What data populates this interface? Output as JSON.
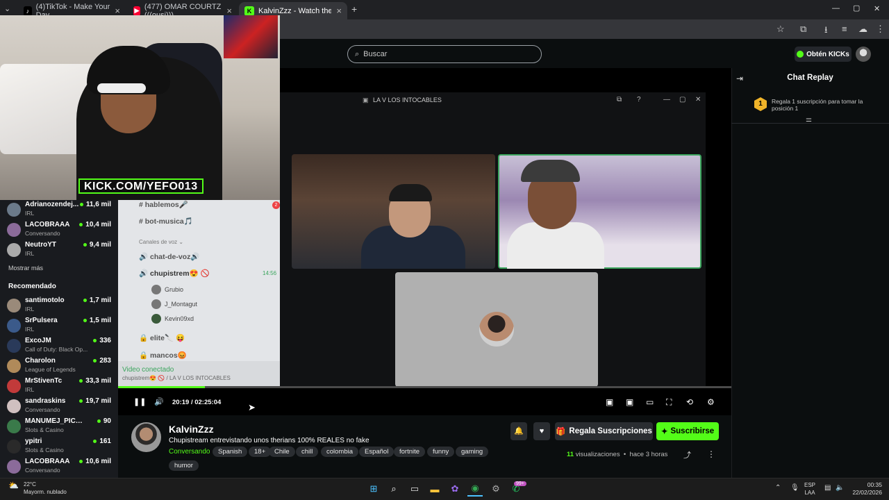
{
  "browser": {
    "tabs": [
      {
        "title": "(4)TikTok - Make Your Day",
        "icon": "tiktok-icon",
        "close": "×"
      },
      {
        "title": "(477) OMAR COURTZ (((ousi))).",
        "icon": "youtube-icon",
        "close": "×"
      },
      {
        "title": "KalvinZzz - Watch the VOD",
        "icon": "kick-icon",
        "close": "×"
      }
    ],
    "new_tab": "+",
    "tab_menu": "⌄",
    "window_controls": [
      "—",
      "▢",
      "✕"
    ],
    "toolbar_icons": [
      "☆",
      "⧉",
      "⭳",
      "≡",
      "☁",
      "⋮"
    ]
  },
  "kick_header": {
    "search_placeholder": "Buscar",
    "kicks_button": "Obtén KICKs"
  },
  "stream_overlay": {
    "kick_url": "KICK.COM/YEFO013"
  },
  "sidebar": {
    "following": [
      {
        "name": "Adrianozendej...",
        "category": "IRL",
        "viewers": "11,6 mil",
        "avatar_color": "#6b7a8a"
      },
      {
        "name": "LACOBRAAA",
        "category": "Conversando",
        "viewers": "10,4 mil",
        "avatar_color": "#8b6b9a"
      },
      {
        "name": "NeutroYT",
        "category": "IRL",
        "viewers": "9,4 mil",
        "avatar_color": "#aaaaaa"
      }
    ],
    "show_more": "Mostrar más",
    "recommended_label": "Recomendado",
    "recommended": [
      {
        "name": "santimotolo",
        "category": "IRL",
        "viewers": "1,7 mil",
        "avatar_color": "#9a8a7a"
      },
      {
        "name": "SrPulsera",
        "category": "IRL",
        "viewers": "1,5 mil",
        "avatar_color": "#3b5a8a"
      },
      {
        "name": "ExcoJM",
        "category": "Call of Duty: Black Op...",
        "viewers": "336",
        "avatar_color": "#2a3a5a"
      },
      {
        "name": "Charolon",
        "category": "League of Legends",
        "viewers": "283",
        "avatar_color": "#b08a5a"
      },
      {
        "name": "MrStivenTc",
        "category": "IRL",
        "viewers": "33,3 mil",
        "avatar_color": "#c23a3a"
      },
      {
        "name": "sandraskins",
        "category": "Conversando",
        "viewers": "19,7 mil",
        "avatar_color": "#d0c0c0"
      },
      {
        "name": "MANUMEJ_PICKS",
        "category": "Slots & Casino",
        "viewers": "90",
        "avatar_color": "#3a7a4a"
      },
      {
        "name": "ypitri",
        "category": "Slots & Casino",
        "viewers": "161",
        "avatar_color": "#2a2a2a"
      },
      {
        "name": "LACOBRAAA",
        "category": "Conversando",
        "viewers": "10,6 mil",
        "avatar_color": "#8b6b9a"
      }
    ]
  },
  "discord": {
    "channels": [
      {
        "name": "# hablemos🎤",
        "badge": "2"
      },
      {
        "name": "# bot-musica🎵",
        "badge": ""
      }
    ],
    "voice_label": "Canales de voz ⌄",
    "voice_channels": [
      {
        "name": "🔊 chat-de-voz🔊"
      },
      {
        "name": "🔊 chupistrem😍 🚫",
        "time": "14:56"
      }
    ],
    "members": [
      "Grubio",
      "J_Montagut",
      "Kevin09xd"
    ],
    "locked": [
      "🔒 elite🔪 😝",
      "🔒 mancos😡"
    ],
    "connected_label": "Video conectado",
    "connected_sub": "chupistrem😍 🚫 / LA V LOS INTOCABLES",
    "window_title": "LA V LOS INTOCABLES",
    "window_controls": [
      "⧉",
      "?",
      "—",
      "▢",
      "✕"
    ]
  },
  "player": {
    "progress_fraction": 0.142,
    "time_current": "20:19",
    "time_total": "02:25:04",
    "time_sep": "/",
    "icons": {
      "pause": "❚❚",
      "volume": "🔊",
      "clip": "▣",
      "theater": "▭",
      "fullscreen": "⛶",
      "speed": "⟲",
      "settings": "⚙"
    }
  },
  "chat": {
    "title": "Chat Replay",
    "gift_rank": "1",
    "gift_text": "Regala 1 suscripción para tomar la posición 1"
  },
  "channel": {
    "name": "KalvinZzz",
    "title": "Chupistream entrevistando unos therians 100% REALES no fake",
    "category": "Conversando",
    "tags": [
      "Spanish",
      "18+",
      "Chile",
      "chill",
      "colombia",
      "Español",
      "fortnite",
      "funny",
      "gaming",
      "humor"
    ],
    "gift_button": "Regala Suscripciones",
    "subscribe_button": "Suscribirse",
    "views_count": "11",
    "views_label": "visualizaciones",
    "uploaded": "hace 3 horas"
  },
  "taskbar": {
    "weather_temp": "22°C",
    "weather_desc": "Mayorm. nublado",
    "lang_top": "ESP",
    "lang_bottom": "LAA",
    "time": "00:35",
    "date": "22/02/2026",
    "badge": "99+"
  },
  "colors": {
    "kick_green": "#53fc18",
    "bg": "#0b0e0f",
    "discord_green": "#3ba55d"
  }
}
